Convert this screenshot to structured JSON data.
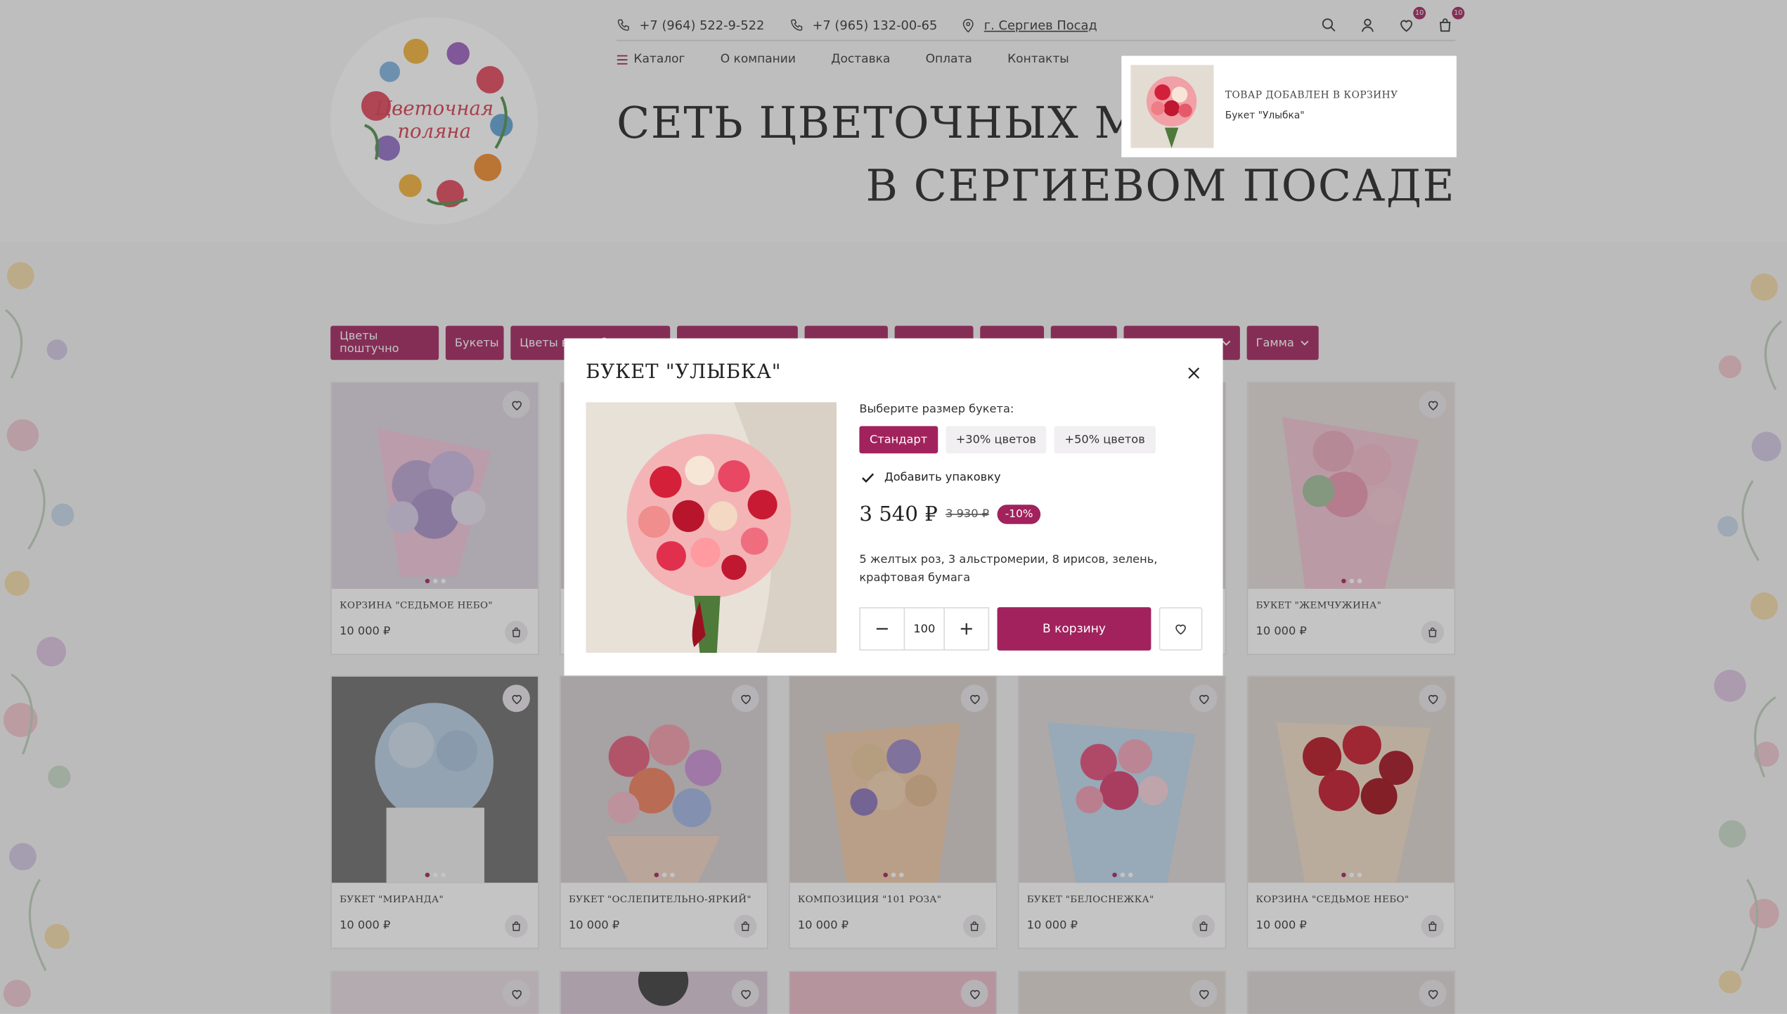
{
  "header": {
    "phone1": "+7 (964) 522-9-522",
    "phone2": "+7 (965) 132-00-65",
    "city": "г. Сергиев Посад",
    "wishlist_count": "10",
    "cart_count": "10",
    "logo_text_line1": "Цветочная",
    "logo_text_line2": "поляна"
  },
  "nav": {
    "catalog": "Каталог",
    "about": "О компании",
    "delivery": "Доставка",
    "payment": "Оплата",
    "contacts": "Контакты"
  },
  "hero": {
    "line1": "СЕТЬ ЦВЕТОЧНЫХ МАГАЗИНОВ",
    "line2": "В СЕРГИЕВОМ ПОСАДЕ"
  },
  "filters": [
    {
      "label": "Цветы поштучно",
      "dropdown": false
    },
    {
      "label": "Букеты",
      "dropdown": false
    },
    {
      "label": "Цветы в коробке",
      "dropdown": false
    },
    {
      "label": "",
      "dropdown": false
    },
    {
      "label": "",
      "dropdown": false
    },
    {
      "label": "",
      "dropdown": false
    },
    {
      "label": "",
      "dropdown": false
    },
    {
      "label": "",
      "dropdown": false
    },
    {
      "label": "",
      "dropdown": true
    },
    {
      "label": "Гамма",
      "dropdown": true
    }
  ],
  "products_row1": [
    {
      "name": "КОРЗИНА \"СЕДЬМОЕ НЕБО\"",
      "price": "10 000 ₽"
    },
    {
      "name": "",
      "price": ""
    },
    {
      "name": "",
      "price": ""
    },
    {
      "name": "",
      "price": ""
    },
    {
      "name": "БУКЕТ \"ЖЕМЧУЖИНА\"",
      "price": "10 000 ₽"
    }
  ],
  "products_row2": [
    {
      "name": "БУКЕТ \"МИРАНДА\"",
      "price": "10 000 ₽"
    },
    {
      "name": "БУКЕТ \"ОСЛЕПИТЕЛЬНО-ЯРКИЙ\"",
      "price": "10 000 ₽"
    },
    {
      "name": "КОМПОЗИЦИЯ \"101 РОЗА\"",
      "price": "10 000 ₽"
    },
    {
      "name": "БУКЕТ \"БЕЛОСНЕЖКА\"",
      "price": "10 000 ₽"
    },
    {
      "name": "КОРЗИНА \"СЕДЬМОЕ НЕБО\"",
      "price": "10 000 ₽"
    }
  ],
  "toast": {
    "title": "ТОВАР ДОБАВЛЕН В КОРЗИНУ",
    "product": "Букет \"Улыбка\""
  },
  "modal": {
    "title": "БУКЕТ \"УЛЫБКА\"",
    "size_label": "Выберите размер букета:",
    "sizes": [
      "Стандарт",
      "+30% цветов",
      "+50% цветов"
    ],
    "selected_size": "Стандарт",
    "packaging_label": "Добавить упаковку",
    "packaging_checked": true,
    "price": "3 540 ₽",
    "old_price": "3 930 ₽",
    "discount": "-10%",
    "description": "5 желтых роз, 3 альстромерии, 8 ирисов, зелень, крафтовая бумага",
    "quantity": "100",
    "add_to_cart": "В корзину"
  },
  "colors": {
    "accent": "#a1225d",
    "background": "#f4f2f4"
  }
}
